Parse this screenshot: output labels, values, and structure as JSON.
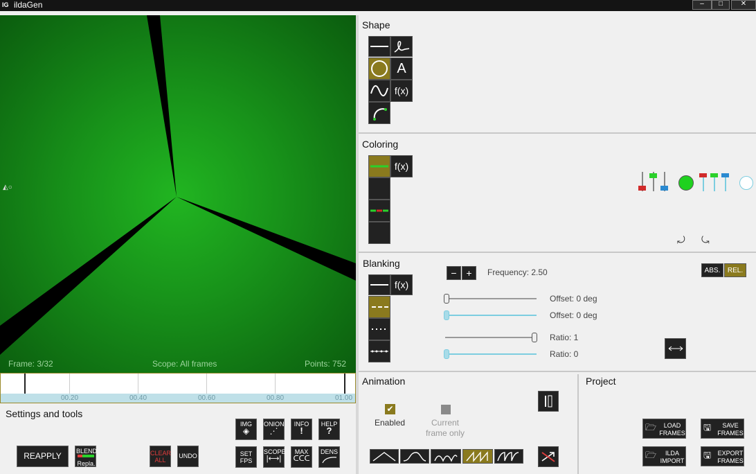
{
  "app": {
    "logo": "IG",
    "title": "ildaGen"
  },
  "window_controls": {
    "minimize": "–",
    "maximize": "□",
    "close": "✕"
  },
  "viewport": {
    "frame": "Frame: 3/32",
    "scope": "Scope: All frames",
    "points": "Points: 752"
  },
  "timeline": {
    "ticks": [
      "00.20",
      "00.40",
      "00.60",
      "00.80",
      "01.00"
    ]
  },
  "shape": {
    "title": "Shape",
    "text_tool": "A",
    "fx_tool": "f(x)"
  },
  "coloring": {
    "title": "Coloring",
    "fx_tool": "f(x)"
  },
  "blanking": {
    "title": "Blanking",
    "fx_tool": "f(x)",
    "minus": "−",
    "plus": "+",
    "frequency": "Frequency: 2.50",
    "abs": "ABS.",
    "rel": "REL.",
    "offset1": "Offset: 0 deg",
    "offset2": "Offset: 0 deg",
    "ratio1": "Ratio: 1",
    "ratio2": "Ratio: 0"
  },
  "animation": {
    "title": "Animation",
    "enabled": "Enabled",
    "current_frame_only_1": "Current",
    "current_frame_only_2": "frame only"
  },
  "project": {
    "title": "Project",
    "load_1": "LOAD",
    "load_2": "FRAMES",
    "save_1": "SAVE",
    "save_2": "FRAMES",
    "ilda_1": "ILDA",
    "ilda_2": "IMPORT",
    "export_1": "EXPORT",
    "export_2": "FRAMES"
  },
  "settings": {
    "title": "Settings and tools",
    "reapply": "REAPPLY",
    "blend": "BLEND",
    "blend_mode": "Repla.",
    "clear_1": "CLEAR",
    "clear_2": "ALL",
    "undo": "UNDO",
    "img": "IMG",
    "onion": "ONION",
    "info": "INFO",
    "info_sym": "!",
    "help": "HELP",
    "help_sym": "?",
    "set_1": "SET",
    "set_2": "FPS",
    "scope": "SCOPE",
    "max": "MAX",
    "dens": "DENS"
  },
  "colors": {
    "accent": "#8a7a1e",
    "viewport_green": "#18931a",
    "clear_red": "#e03c3c"
  }
}
